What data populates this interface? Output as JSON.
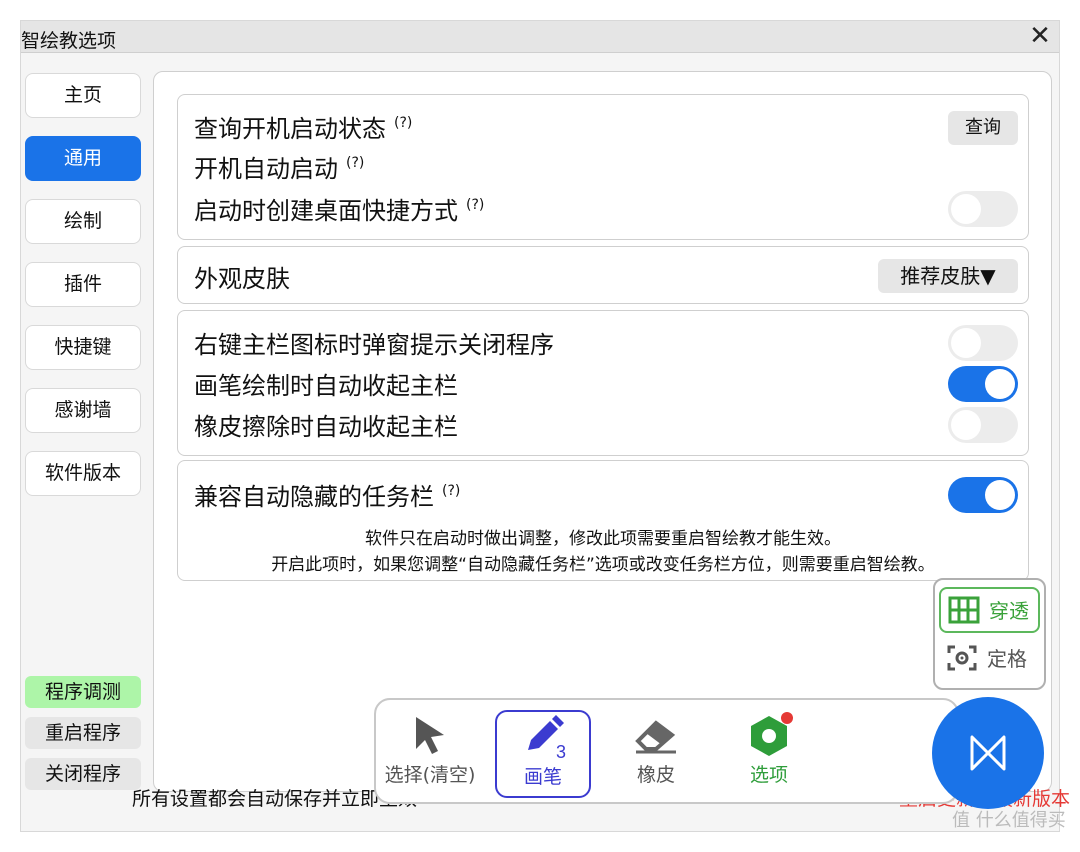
{
  "window": {
    "title": "智绘教选项",
    "close_glyph": "✕"
  },
  "sidebar": {
    "items": [
      {
        "label": "主页"
      },
      {
        "label": "通用"
      },
      {
        "label": "绘制"
      },
      {
        "label": "插件"
      },
      {
        "label": "快捷键"
      },
      {
        "label": "感谢墙"
      },
      {
        "label": "软件版本"
      }
    ],
    "active_index": 1,
    "bottom": [
      {
        "label": "程序调测"
      },
      {
        "label": "重启程序"
      },
      {
        "label": "关闭程序"
      }
    ]
  },
  "settings": {
    "startup": {
      "query_status_label": "查询开机启动状态",
      "query_button": "查询",
      "autostart_label": "开机自动启动",
      "desktop_shortcut_label": "启动时创建桌面快捷方式",
      "desktop_shortcut_on": false,
      "help_glyph": "(?)"
    },
    "skin": {
      "label": "外观皮肤",
      "selected": "推荐皮肤▼"
    },
    "behavior": [
      {
        "label": "右键主栏图标时弹窗提示关闭程序",
        "on": false
      },
      {
        "label": "画笔绘制时自动收起主栏",
        "on": true
      },
      {
        "label": "橡皮擦除时自动收起主栏",
        "on": false
      }
    ],
    "taskbar": {
      "label": "兼容自动隐藏的任务栏",
      "on": true,
      "note_line1": "软件只在启动时做出调整，修改此项需要重启智绘教才能生效。",
      "note_line2": "开启此项时，如果您调整“自动隐藏任务栏”选项或改变任务栏方位，则需要重启智绘教。"
    }
  },
  "footer": {
    "autosave_text": "所有设置都会自动保存并立即生效",
    "update_text": "重启更新到最新版本"
  },
  "toolbar": {
    "tools": [
      {
        "label": "选择(清空)",
        "icon": "cursor-icon"
      },
      {
        "label": "画笔",
        "icon": "pen-icon",
        "badge": "3"
      },
      {
        "label": "橡皮",
        "icon": "eraser-icon"
      },
      {
        "label": "选项",
        "icon": "options-icon"
      }
    ]
  },
  "float_panel": {
    "penetrate": "穿透",
    "freeze": "定格"
  },
  "watermark": "值 什么值得买",
  "colors": {
    "accent": "#1a73e8",
    "green": "#3aa23a",
    "red": "#e53935",
    "purple": "#3b3bd0"
  }
}
